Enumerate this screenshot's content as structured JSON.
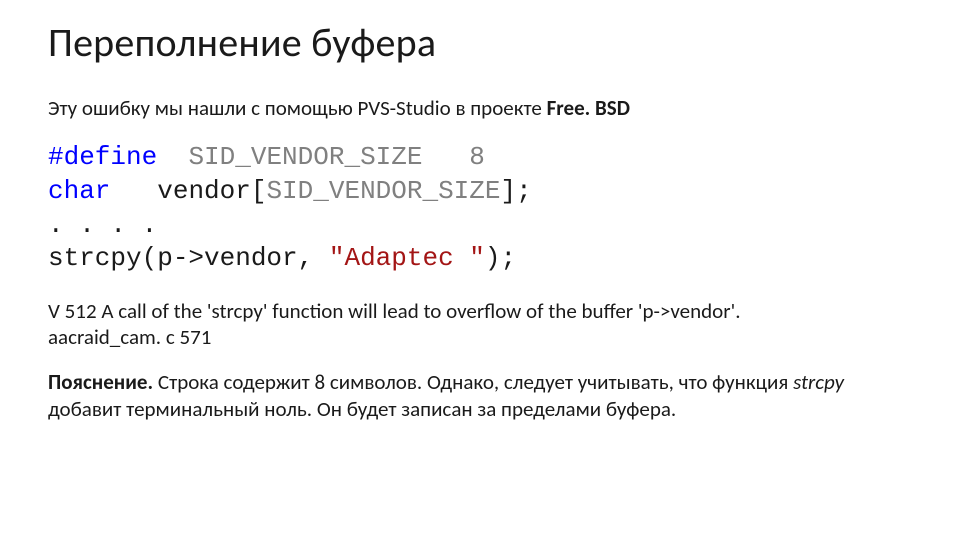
{
  "title": "Переполнение буфера",
  "subtitle": {
    "prefix": "Эту ошибку мы нашли с помощью PVS-Studio в проекте ",
    "project": "Free. BSD"
  },
  "code": {
    "l1": {
      "kw": "#define",
      "sp1": "  ",
      "id": "SID_VENDOR_SIZE",
      "sp2": "   ",
      "num": "8"
    },
    "l2": {
      "kw": "char",
      "sp1": "   ",
      "v1": "vendor[",
      "id": "SID_VENDOR_SIZE",
      "v2": "];"
    },
    "l3": {
      "plain": ". . . ."
    },
    "l4": {
      "fn": "strcpy(p->vendor, ",
      "str": "\"Adaptec \"",
      "tail": ");"
    }
  },
  "diag": {
    "line1": "V 512 A call of the 'strcpy' function will lead to overflow of the buffer 'p->vendor'.",
    "line2": "aacraid_cam. c 571"
  },
  "explain": {
    "lead": "Пояснение.",
    "p1a": " Строка содержит 8 символов. Однако, следует учитывать, что функция ",
    "em": "strcpy",
    "p1b": " добавит терминальный ноль. Он будет записан за пределами буфера."
  }
}
